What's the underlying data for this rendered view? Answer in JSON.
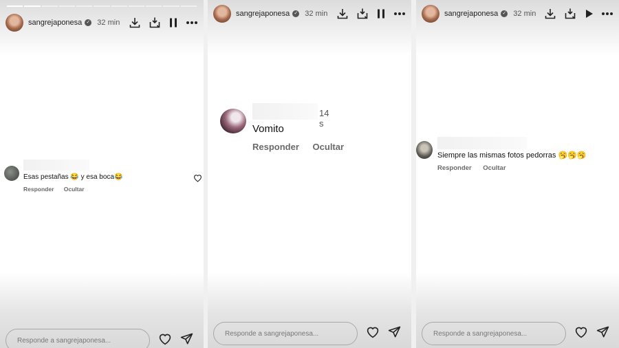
{
  "story": {
    "username": "sangrejaponesa",
    "time_ago": "32 min",
    "reply_placeholder": "Responde a sangrejaponesa..."
  },
  "panels": [
    {
      "playback": "pause",
      "comment": {
        "text": "Esas pestañas 😂 y esa boca😂",
        "actions": [
          "Responder",
          "Ocultar"
        ],
        "time": ""
      }
    },
    {
      "playback": "pause",
      "comment": {
        "text": "Vomito",
        "actions": [
          "Responder",
          "Ocultar"
        ],
        "time": "14 s"
      }
    },
    {
      "playback": "play",
      "comment": {
        "text": "Siempre las mismas fotos pedorras 🥱🥱🥱",
        "actions": [
          "Responder",
          "Ocultar"
        ],
        "time": ""
      }
    }
  ],
  "icons": [
    "download-icon",
    "save-to-device-icon",
    "pause-icon",
    "play-icon",
    "more-icon",
    "heart-icon",
    "send-icon",
    "verified-badge-icon"
  ]
}
